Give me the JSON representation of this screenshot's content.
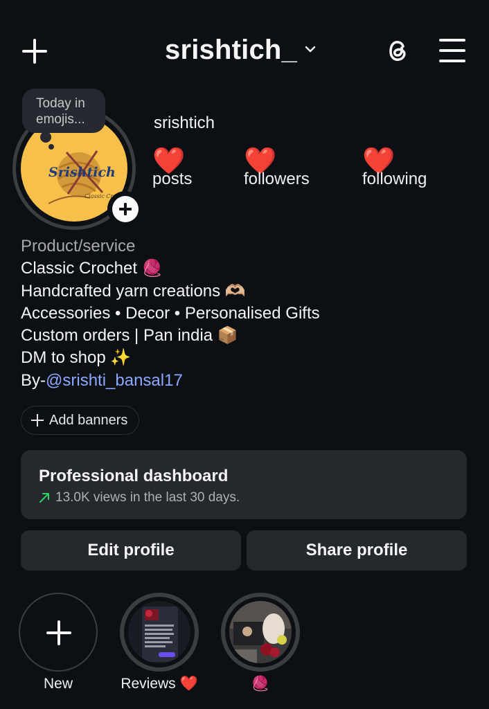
{
  "header": {
    "username": "srishtich_"
  },
  "profile": {
    "note": "Today in emojis...",
    "avatar_brand": "Srishtich",
    "avatar_tagline": "Classic Crochet",
    "display_name": "srishtich",
    "stats": [
      {
        "value": "❤️",
        "label": "posts"
      },
      {
        "value": "❤️",
        "label": "followers"
      },
      {
        "value": "❤️",
        "label": "following"
      }
    ]
  },
  "bio": {
    "category": "Product/service",
    "lines": [
      "Classic Crochet 🧶",
      "Handcrafted yarn creations 🫶🏼",
      "Accessories • Decor • Personalised Gifts",
      "Custom orders | Pan india 📦",
      "DM to shop ✨"
    ],
    "by_prefix": "By-",
    "mention": "@srishti_bansal17"
  },
  "banners": {
    "label": "Add banners"
  },
  "dashboard": {
    "title": "Professional dashboard",
    "subtitle": "13.0K views in the last 30 days.",
    "trend_color": "#2fd264"
  },
  "actions": {
    "edit": "Edit profile",
    "share": "Share profile"
  },
  "highlights": [
    {
      "label": "New"
    },
    {
      "label": "Reviews ❤️"
    },
    {
      "label": "🧶"
    }
  ]
}
